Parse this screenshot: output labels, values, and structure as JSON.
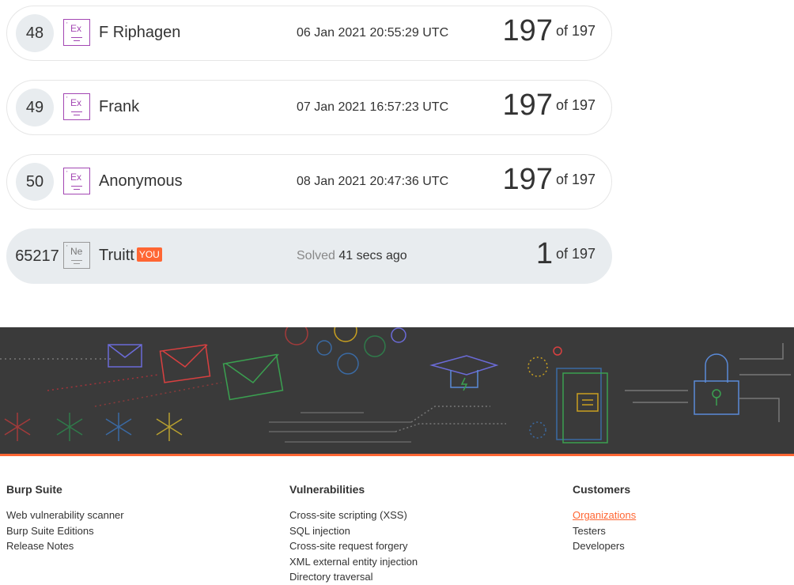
{
  "leaderboard": [
    {
      "rank": "48",
      "badge": "Ex",
      "name": "F Riphagen",
      "time": "06 Jan 2021 20:55:29 UTC",
      "score": "197",
      "of": "of 197"
    },
    {
      "rank": "49",
      "badge": "Ex",
      "name": "Frank",
      "time": "07 Jan 2021 16:57:23 UTC",
      "score": "197",
      "of": "of 197"
    },
    {
      "rank": "50",
      "badge": "Ex",
      "name": "Anonymous",
      "time": "08 Jan 2021 20:47:36 UTC",
      "score": "197",
      "of": "of 197"
    }
  ],
  "me": {
    "rank": "65217",
    "badge": "Ne",
    "name": "Truitt",
    "you": "YOU",
    "solved_label": "Solved",
    "solved_time": "41 secs ago",
    "score": "1",
    "of": "of 197"
  },
  "footer": {
    "columns": [
      {
        "heading": "Burp Suite",
        "links": [
          "Web vulnerability scanner",
          "Burp Suite Editions",
          "Release Notes"
        ]
      },
      {
        "heading": "Vulnerabilities",
        "links": [
          "Cross-site scripting (XSS)",
          "SQL injection",
          "Cross-site request forgery",
          "XML external entity injection",
          "Directory traversal"
        ]
      },
      {
        "heading": "Customers",
        "links": [
          "Organizations",
          "Testers",
          "Developers"
        ]
      }
    ]
  },
  "colors": {
    "accent": "#ff6633",
    "expert_badge": "#a347b3",
    "banner_bg": "#3a3a3a"
  }
}
